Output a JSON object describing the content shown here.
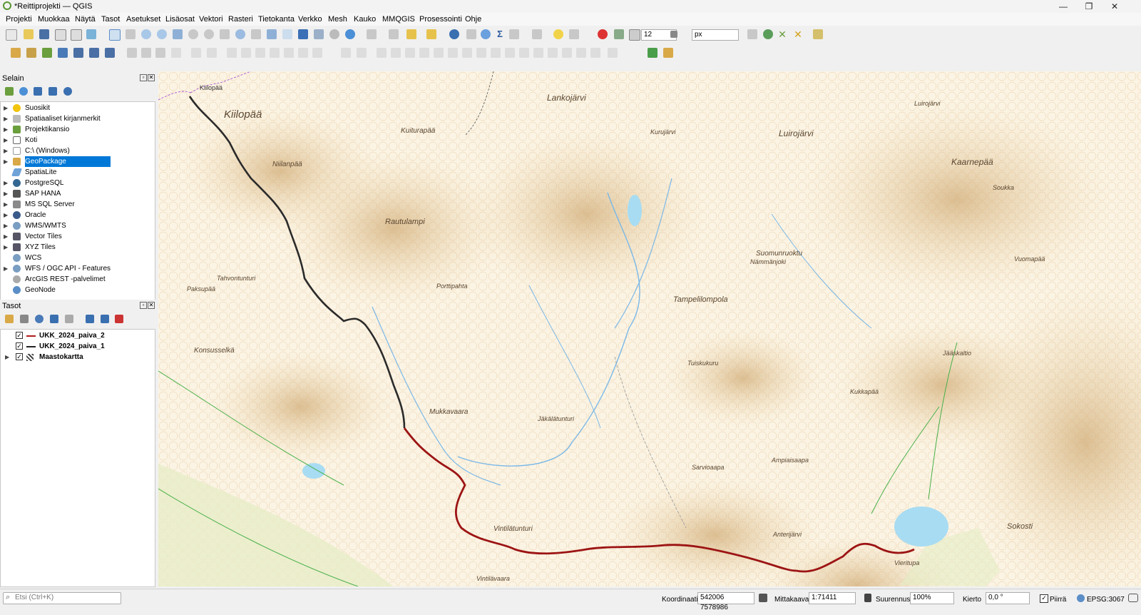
{
  "window": {
    "title": "*Reittiprojekti — QGIS"
  },
  "menu": [
    "Projekti",
    "Muokkaa",
    "Näytä",
    "Tasot",
    "Asetukset",
    "Lisäosat",
    "Vektori",
    "Rasteri",
    "Tietokanta",
    "Verkko",
    "Mesh",
    "Kauko",
    "MMQGIS",
    "Prosessointi",
    "Ohje"
  ],
  "toolbar": {
    "snap_tolerance": "12",
    "snap_unit": "px"
  },
  "browser": {
    "title": "Selain",
    "items": [
      {
        "label": "Suosikit",
        "icon": "star-icon"
      },
      {
        "label": "Spatiaaliset kirjanmerkit",
        "icon": "bookmark-icon"
      },
      {
        "label": "Projektikansio",
        "icon": "folder-icon"
      },
      {
        "label": "Koti",
        "icon": "home-icon"
      },
      {
        "label": "C:\\ (Windows)",
        "icon": "drive-icon"
      },
      {
        "label": "GeoPackage",
        "icon": "geopackage-icon",
        "selected": true
      },
      {
        "label": "SpatiaLite",
        "icon": "spatialite-icon"
      },
      {
        "label": "PostgreSQL",
        "icon": "postgresql-icon"
      },
      {
        "label": "SAP HANA",
        "icon": "saphana-icon"
      },
      {
        "label": "MS SQL Server",
        "icon": "mssql-icon"
      },
      {
        "label": "Oracle",
        "icon": "oracle-icon"
      },
      {
        "label": "WMS/WMTS",
        "icon": "globe-icon"
      },
      {
        "label": "Vector Tiles",
        "icon": "grid-icon"
      },
      {
        "label": "XYZ Tiles",
        "icon": "grid-icon"
      },
      {
        "label": "WCS",
        "icon": "globe-icon"
      },
      {
        "label": "WFS / OGC API - Features",
        "icon": "globe-icon"
      },
      {
        "label": "ArcGIS REST -palvelimet",
        "icon": "arcgis-icon"
      },
      {
        "label": "GeoNode",
        "icon": "geonode-icon"
      }
    ]
  },
  "layers": {
    "title": "Tasot",
    "items": [
      {
        "label": "UKK_2024_paiva_2",
        "checked": true,
        "color": "#b01a1a"
      },
      {
        "label": "UKK_2024_paiva_1",
        "checked": true,
        "color": "#222222"
      },
      {
        "label": "Maastokartta",
        "checked": true,
        "color": "#444444"
      }
    ]
  },
  "map": {
    "labels": [
      "Kiilopää",
      "Kiilopää",
      "Lankojärvi",
      "Kuiturapää",
      "Luirojärvi",
      "Kaarnepää",
      "Niilanpää",
      "Rautulampi",
      "Suomunruoktu",
      "Tahvontunturi",
      "Paksupää",
      "Porttipahta",
      "Tuiskukuru",
      "Tampelilompola",
      "Konsusselkä",
      "Mukkavaara",
      "Vintilätunturi",
      "Sarvioaapa",
      "Anterijärvi",
      "Sokosti",
      "Vintilävaara",
      "Jäkälätunturi",
      "Luirojärvi",
      "Vieritupa",
      "Ampiaisaapa",
      "Kurujärvi",
      "Nämmänjoki",
      "Vuomapää",
      "Jääskaltio",
      "Kukkapää",
      "Soukka"
    ]
  },
  "statusbar": {
    "search_placeholder": "Etsi (Ctrl+K)",
    "coords_label": "Koordinaatit",
    "coords": "542006 7578986",
    "scale_label": "Mittakaava",
    "scale": "1:71411",
    "zoom_label": "Suurennus",
    "zoom": "100%",
    "rotation_label": "Kierto",
    "rotation": "0,0 °",
    "render_label": "Piirrä",
    "crs": "EPSG:3067"
  }
}
